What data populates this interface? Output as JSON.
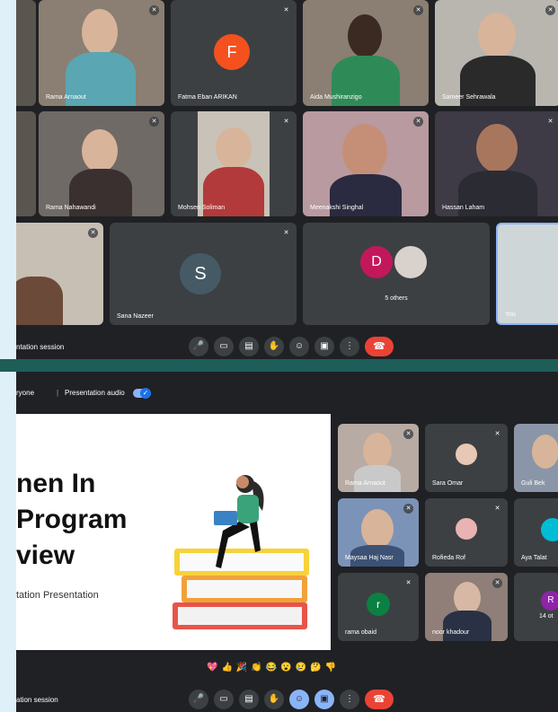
{
  "top_call": {
    "tiles": [
      {
        "name": "Rama Arnaout"
      },
      {
        "name": "Fatma Eban ARIKAN",
        "initial": "F",
        "color": "#f4511e"
      },
      {
        "name": "Aida Mushiranzigo"
      },
      {
        "name": "Sameer Sehrawala"
      },
      {
        "name": "Rama Nahawandi"
      },
      {
        "name": "Mohsen Soliman"
      },
      {
        "name": "Meenakshi Singhal"
      },
      {
        "name": "Hassan Laham"
      },
      {
        "name": "Sana Nazeer",
        "initial": "S",
        "color": "#455a64"
      },
      {
        "name": "5 others",
        "initial": "D",
        "color": "#c2185b"
      },
      {
        "name": "You"
      }
    ],
    "session_label": "ntation session"
  },
  "bottom_call": {
    "header_text": "ryone",
    "presentation_audio": "Presentation audio",
    "slide": {
      "title_line1": "nen In",
      "title_line2": "Program",
      "title_line3": "view",
      "subtitle": "tation Presentation"
    },
    "tiles": [
      {
        "name": "Rama Arnaout"
      },
      {
        "name": "Sara Omar"
      },
      {
        "name": "Guli Bek"
      },
      {
        "name": "Maysaa Haj Nasr"
      },
      {
        "name": "Rofieda Rof"
      },
      {
        "name": "Aya Talat"
      },
      {
        "name": "rama obaid",
        "initial": "r",
        "color": "#0b8043"
      },
      {
        "name": "noor khadour"
      },
      {
        "name": "14 ot",
        "initial": "R",
        "color": "#8e24aa"
      }
    ],
    "reactions": [
      "💖",
      "👍",
      "🎉",
      "👏",
      "😂",
      "😮",
      "😢",
      "🤔",
      "👎"
    ],
    "session_label": "ation session"
  },
  "toolbar_icons": [
    "mic-icon",
    "camera-icon",
    "captions-icon",
    "raise-hand-icon",
    "emoji-icon",
    "present-icon",
    "more-icon",
    "end-call-icon"
  ],
  "colors": {
    "meet_bg": "#202124",
    "tile_bg": "#3c4043",
    "end_call": "#ea4335",
    "accent": "#8ab4f8"
  }
}
